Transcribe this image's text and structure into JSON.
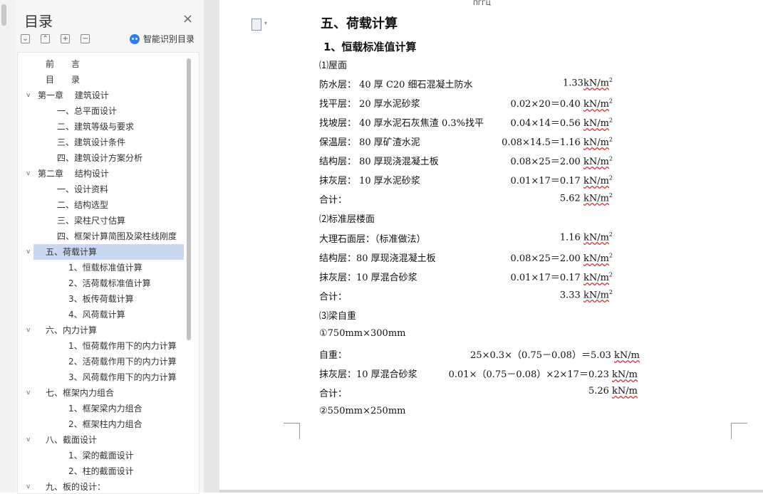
{
  "toc": {
    "title": "目录",
    "close": "×",
    "tools": [
      "⌄",
      "⌃",
      "+",
      "−"
    ],
    "smart_label": "智能识别目录",
    "items": [
      {
        "label": "前　　言",
        "level": 1,
        "caret": ""
      },
      {
        "label": "目　　录",
        "level": 1,
        "caret": ""
      },
      {
        "label": "第一章　 建筑设计",
        "level": 0,
        "caret": "v"
      },
      {
        "label": "一、总平面设计",
        "level": 2,
        "caret": ""
      },
      {
        "label": "二、建筑等级与要求",
        "level": 2,
        "caret": ""
      },
      {
        "label": "三、建筑设计条件",
        "level": 2,
        "caret": ""
      },
      {
        "label": "四、建筑设计方案分析",
        "level": 2,
        "caret": ""
      },
      {
        "label": "第二章　 结构设计",
        "level": 0,
        "caret": "v"
      },
      {
        "label": "一、设计资料",
        "level": 2,
        "caret": ""
      },
      {
        "label": "二、结构选型",
        "level": 2,
        "caret": ""
      },
      {
        "label": "三、梁柱尺寸估算",
        "level": 2,
        "caret": ""
      },
      {
        "label": "四、框架计算简图及梁柱线刚度",
        "level": 2,
        "caret": ""
      },
      {
        "label": "五、荷载计算",
        "level": 1,
        "caret": "v",
        "selected": true
      },
      {
        "label": "1、恒载标准值计算",
        "level": 3,
        "caret": ""
      },
      {
        "label": "2、活荷载标准值计算",
        "level": 3,
        "caret": ""
      },
      {
        "label": "3、板传荷载计算",
        "level": 3,
        "caret": ""
      },
      {
        "label": "4、风荷载计算",
        "level": 3,
        "caret": ""
      },
      {
        "label": "六、内力计算",
        "level": 1,
        "caret": "v"
      },
      {
        "label": "1、恒荷载作用下的内力计算",
        "level": 3,
        "caret": ""
      },
      {
        "label": "2、活荷载作用下的内力计算",
        "level": 3,
        "caret": ""
      },
      {
        "label": "3、风荷载作用下的内力计算",
        "level": 3,
        "caret": ""
      },
      {
        "label": "七、框架内力组合",
        "level": 1,
        "caret": "v"
      },
      {
        "label": "1、框架梁内力组合",
        "level": 3,
        "caret": ""
      },
      {
        "label": "2、框架柱内力组合",
        "level": 3,
        "caret": ""
      },
      {
        "label": "八、截面设计",
        "level": 1,
        "caret": "v"
      },
      {
        "label": "1、梁的截面设计",
        "level": 3,
        "caret": ""
      },
      {
        "label": "2、柱的截面设计",
        "level": 3,
        "caret": ""
      },
      {
        "label": "九、板的设计：",
        "level": 1,
        "caret": "v"
      }
    ]
  },
  "doc": {
    "top_fragment": "ПГГЦ",
    "h1": "五、荷载计算",
    "h2": "1、恒载标准值计算",
    "lines": [
      {
        "label": "⑴屋面",
        "calc": "",
        "unit": "",
        "sup": ""
      },
      {
        "label": "防水层：  40 厚 C20 细石混凝土防水",
        "calc": "1.33",
        "unit": "kN/m",
        "sup": "2"
      },
      {
        "label": "找平层：  20 厚水泥砂浆",
        "calc": "0.02×20＝0.40 ",
        "unit": "kN/m",
        "sup": "2"
      },
      {
        "label": "找坡层：  40 厚水泥石灰焦渣 0.3%找平",
        "calc": "0.04×14＝0.56 ",
        "unit": "kN/m",
        "sup": "2"
      },
      {
        "label": "保温层：  80 厚矿渣水泥",
        "calc": "0.08×14.5＝1.16 ",
        "unit": "kN/m",
        "sup": "2"
      },
      {
        "label": "结构层：  80 厚现浇混凝土板",
        "calc": "0.08×25＝2.00 ",
        "unit": "kN/m",
        "sup": "2"
      },
      {
        "label": "抹灰层：  10 厚水泥砂浆",
        "calc": "0.01×17＝0.17 ",
        "unit": "kN/m",
        "sup": "2"
      },
      {
        "label": "合计：",
        "calc": "5.62 ",
        "unit": "kN/m",
        "sup": "2"
      },
      {
        "label": "⑵标准层楼面",
        "calc": "",
        "unit": "",
        "sup": ""
      },
      {
        "label": "大理石面层：（标准做法）",
        "calc": "1.16 ",
        "unit": "kN/m",
        "sup": "2"
      },
      {
        "label": "结构层：80 厚现浇混凝土板",
        "calc": "0.08×25＝2.00 ",
        "unit": "kN/m",
        "sup": "2"
      },
      {
        "label": "抹灰层：10 厚混合砂浆",
        "calc": "0.01×17＝0.17 ",
        "unit": "kN/m",
        "sup": "2"
      },
      {
        "label": "合计：",
        "calc": "3.33 ",
        "unit": "kN/m",
        "sup": "2"
      },
      {
        "label": "⑶梁自重",
        "calc": "",
        "unit": "",
        "sup": ""
      },
      {
        "label": "①750mm×300mm",
        "calc": "",
        "unit": "",
        "sup": ""
      },
      {
        "label": "自重：",
        "calc": "25×0.3×（0.75－0.08）＝5.03 ",
        "unit": "kN/m",
        "sup": ""
      },
      {
        "label": "抹灰层：10 厚混合砂浆",
        "calc": "0.01×（0.75－0.08）×2×17＝0.23 ",
        "unit": "kN/m",
        "sup": ""
      },
      {
        "label": "合计：",
        "calc": "5.26 ",
        "unit": "kN/m",
        "sup": ""
      },
      {
        "label": "②550mm×250mm",
        "calc": "",
        "unit": "",
        "sup": ""
      }
    ]
  }
}
